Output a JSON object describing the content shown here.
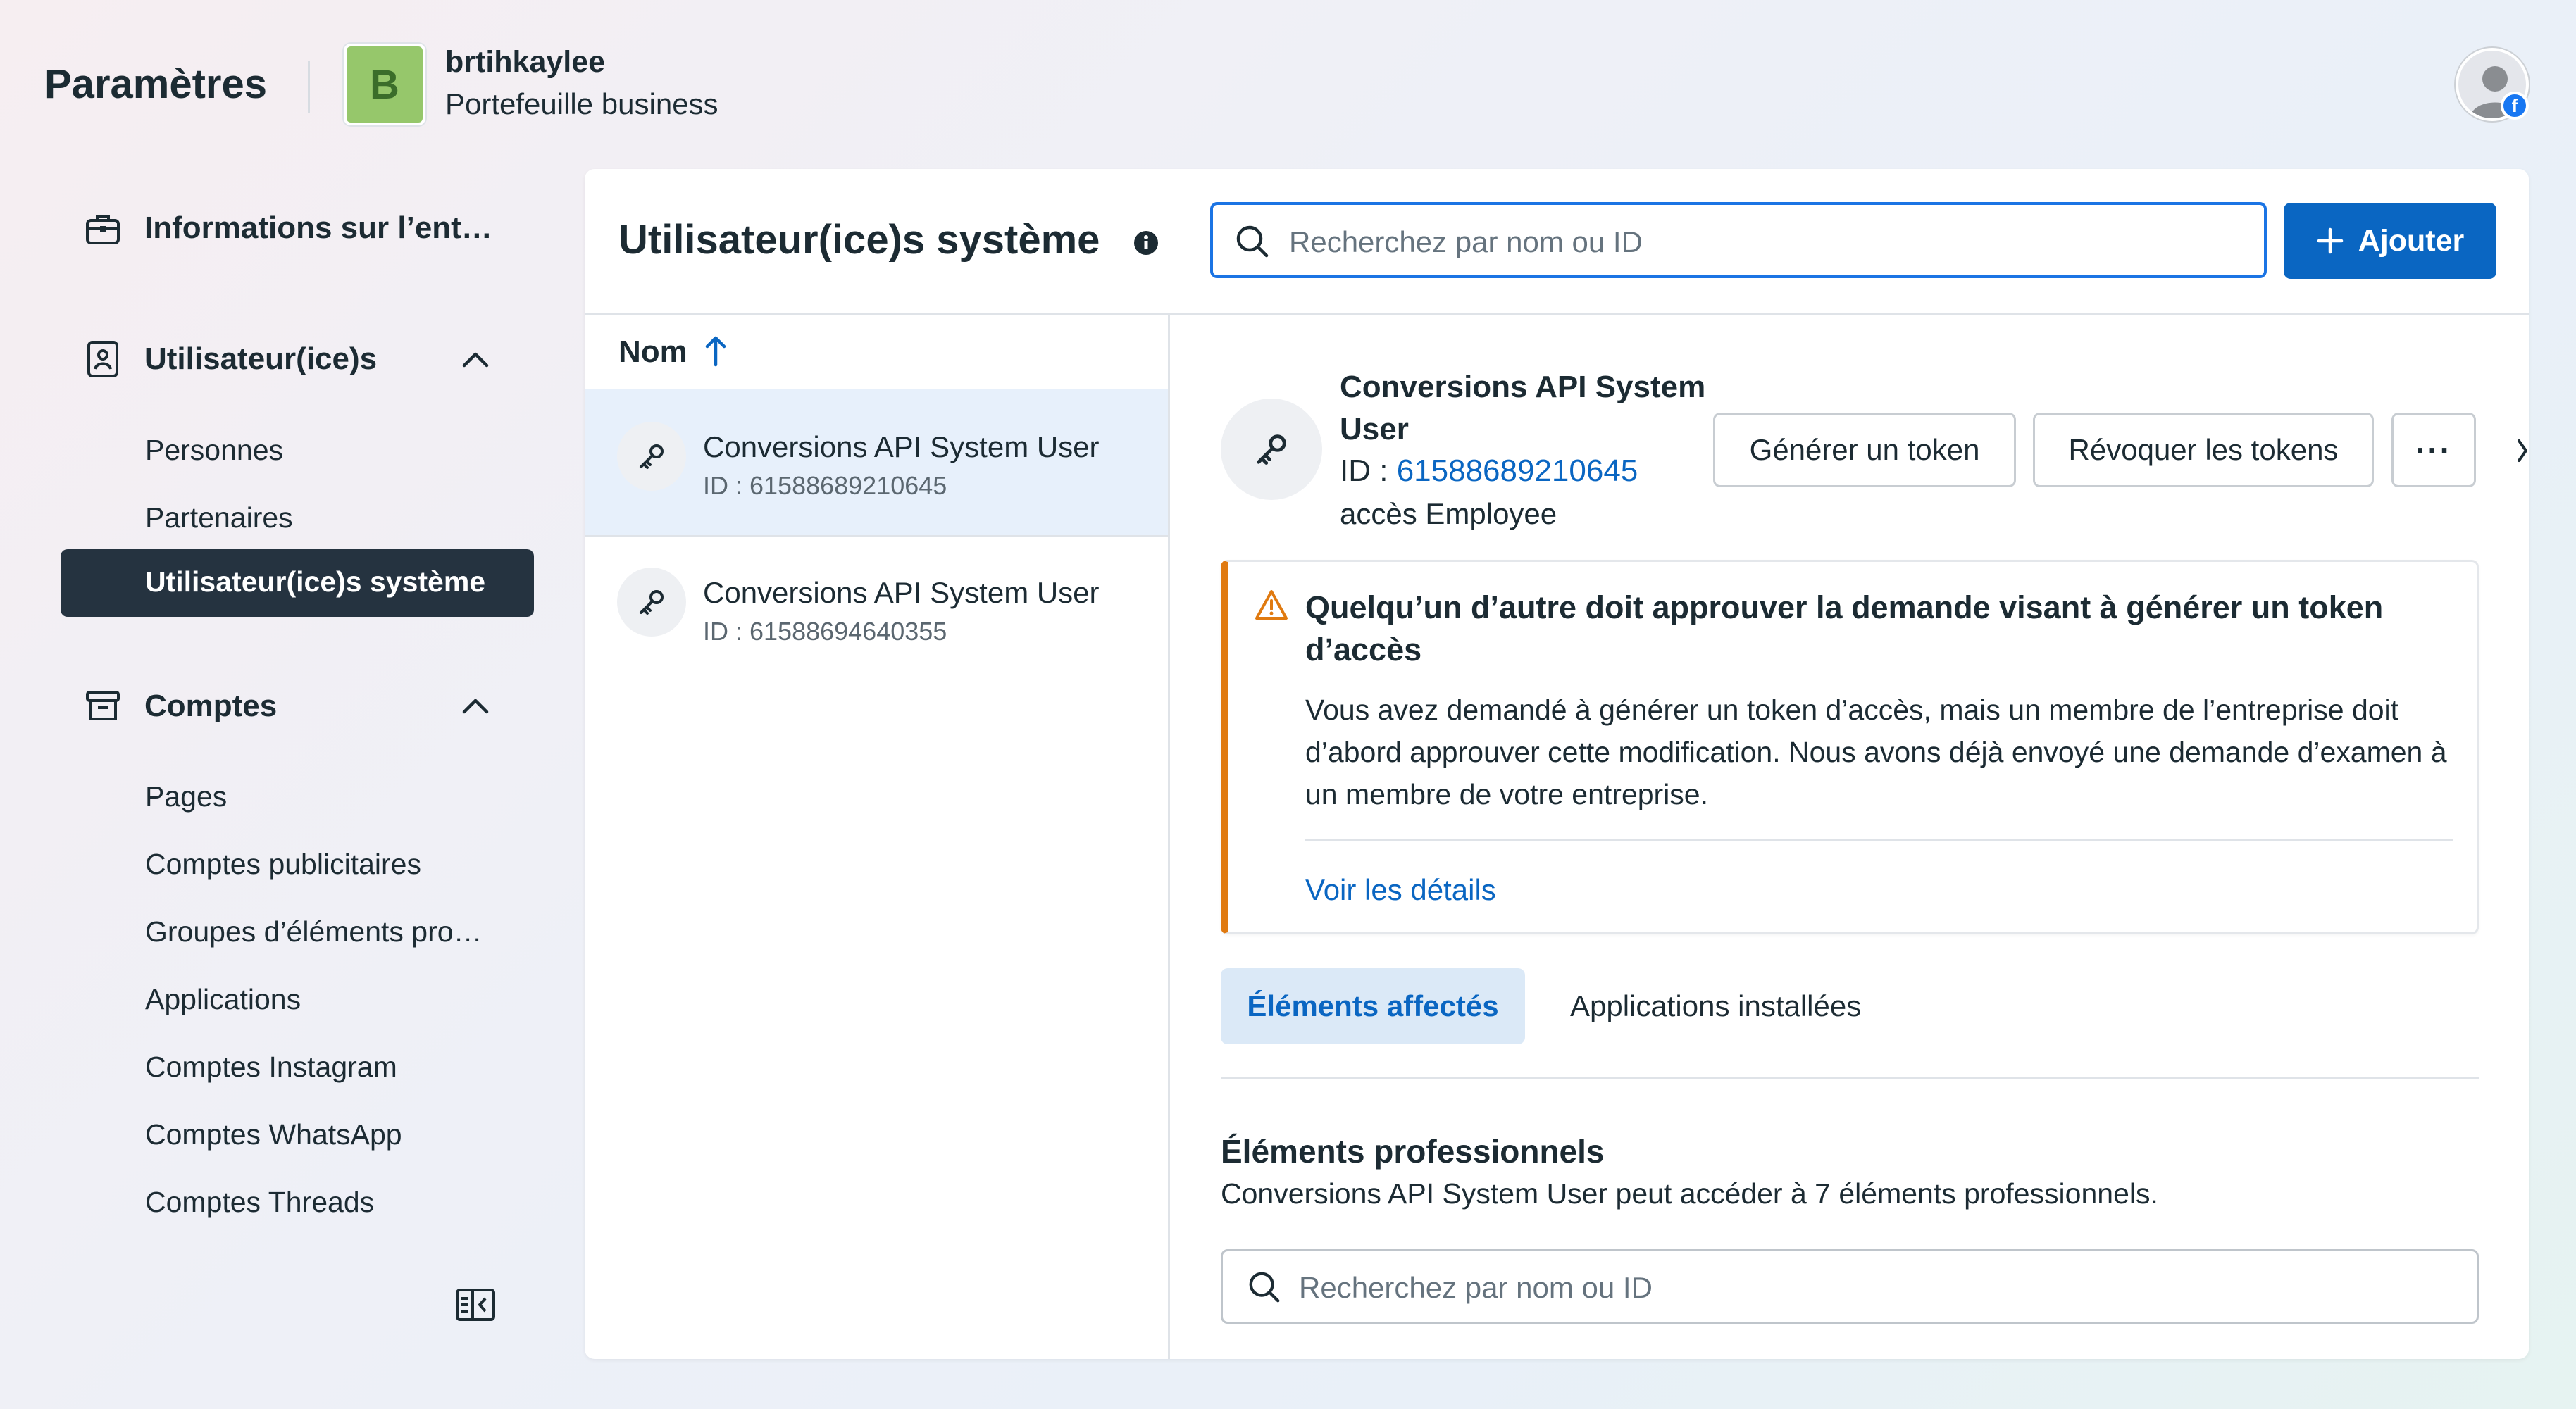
{
  "header": {
    "title": "Paramètres",
    "business_initial": "B",
    "business_name": "brtihkaylee",
    "business_type": "Portefeuille business"
  },
  "sidebar": {
    "company_info": "Informations sur l’ent…",
    "users": {
      "label": "Utilisateur(ice)s",
      "items": [
        "Personnes",
        "Partenaires",
        "Utilisateur(ice)s système"
      ]
    },
    "accounts": {
      "label": "Comptes",
      "items": [
        "Pages",
        "Comptes publicitaires",
        "Groupes d’éléments pro…",
        "Applications",
        "Comptes Instagram",
        "Comptes WhatsApp",
        "Comptes Threads"
      ]
    }
  },
  "main": {
    "title": "Utilisateur(ice)s système",
    "search_placeholder": "Recherchez par nom ou ID",
    "add_label": "Ajouter",
    "column_name": "Nom",
    "rows": [
      {
        "name": "Conversions API System User",
        "id": "ID : 61588689210645"
      },
      {
        "name": "Conversions API System User",
        "id": "ID : 61588694640355"
      }
    ]
  },
  "detail": {
    "name": "Conversions API System User",
    "id_label": "ID : ",
    "id_value": "61588689210645",
    "access": "accès Employee",
    "generate_token": "Générer un token",
    "revoke_tokens": "Révoquer les tokens",
    "more": "···",
    "alert_title": "Quelqu’un d’autre doit approuver la demande visant à générer un token d’accès",
    "alert_body": "Vous avez demandé à générer un token d’accès, mais un membre de l’entreprise doit d’abord approuver cette modification. Nous avons déjà envoyé une demande d’examen à un membre de votre entreprise.",
    "alert_link": "Voir les détails",
    "tabs": [
      "Éléments affectés",
      "Applications installées"
    ],
    "section_title": "Éléments professionnels",
    "section_sub": "Conversions API System User peut accéder à 7 éléments professionnels.",
    "assets_search_placeholder": "Recherchez par nom ou ID"
  },
  "colors": {
    "primary": "#0a66c2",
    "focus": "#1b74e4",
    "warning": "#e07a10",
    "sidebar_active": "#253340",
    "avatar_green": "#96c76b"
  }
}
